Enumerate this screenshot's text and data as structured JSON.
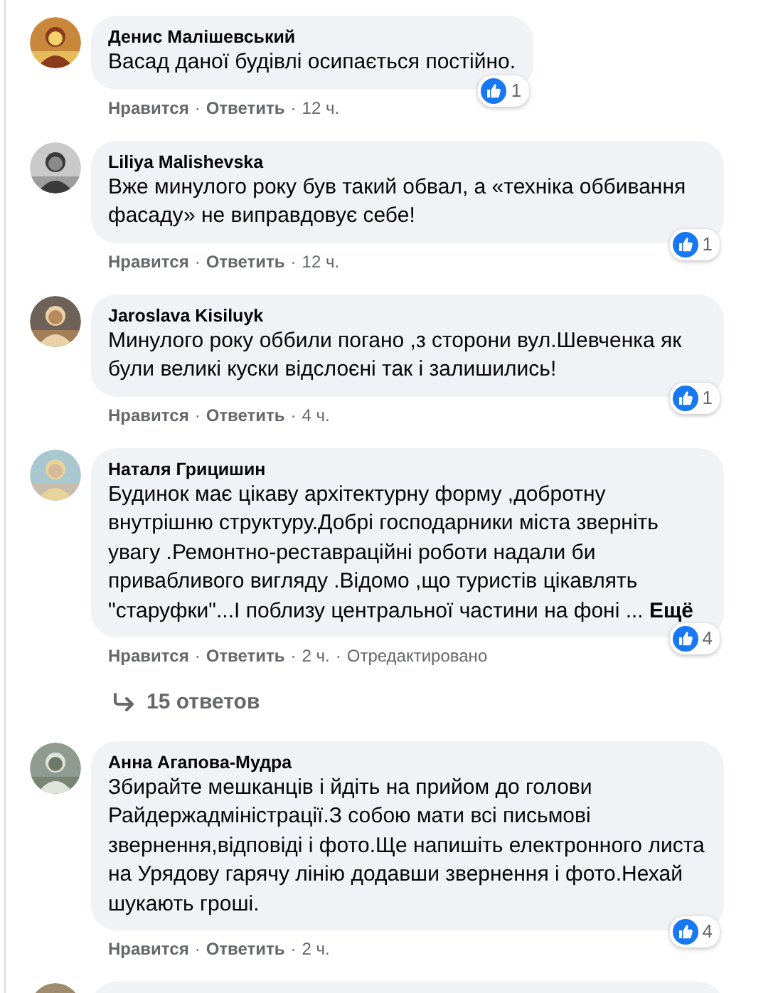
{
  "comments": [
    {
      "author": "Денис Малішевський",
      "text": "Васад даної будівлі осипається постійно.",
      "reactions": "1",
      "actions": [
        {
          "kind": "link",
          "text": "Нравится"
        },
        {
          "kind": "sep",
          "text": "·"
        },
        {
          "kind": "link",
          "text": "Ответить"
        },
        {
          "kind": "sep",
          "text": "·"
        },
        {
          "kind": "time",
          "text": "12 ч."
        }
      ]
    },
    {
      "author": "Liliya Malishevska",
      "text": "Вже минулого року був такий обвал, а «техніка оббивання фасаду» не виправдовує себе!",
      "reactions": "1",
      "actions": [
        {
          "kind": "link",
          "text": "Нравится"
        },
        {
          "kind": "sep",
          "text": "·"
        },
        {
          "kind": "link",
          "text": "Ответить"
        },
        {
          "kind": "sep",
          "text": "·"
        },
        {
          "kind": "time",
          "text": "12 ч."
        }
      ]
    },
    {
      "author": "Jaroslava Kisiluyk",
      "text": "Минулого року оббили погано ,з сторони вул.Шевченка як були великі куски відслоєні так і залишились!",
      "reactions": "1",
      "actions": [
        {
          "kind": "link",
          "text": "Нравится"
        },
        {
          "kind": "sep",
          "text": "·"
        },
        {
          "kind": "link",
          "text": "Ответить"
        },
        {
          "kind": "sep",
          "text": "·"
        },
        {
          "kind": "time",
          "text": "4 ч."
        }
      ]
    },
    {
      "author": "Наталя Грицишин",
      "text": "Будинок має цікаву архітектурну форму ,добротну внутрішню структуру.Добрі господарники міста зверніть увагу .Ремонтно-реставраційні роботи надали би привабливого вигляду .Відомо ,що туристів цікавлять \"старуфки\"...І поблизу центральної частини на фоні ...",
      "more_link": "Ещё",
      "reactions": "4",
      "actions": [
        {
          "kind": "link",
          "text": "Нравится"
        },
        {
          "kind": "sep",
          "text": "·"
        },
        {
          "kind": "link",
          "text": "Ответить"
        },
        {
          "kind": "sep",
          "text": "·"
        },
        {
          "kind": "time",
          "text": "2 ч."
        },
        {
          "kind": "sep",
          "text": "·"
        },
        {
          "kind": "time",
          "text": "Отредактировано"
        }
      ],
      "replies_link": "15 ответов"
    },
    {
      "author": "Анна Агапова-Мудра",
      "text": "Збирайте мешканців і йдіть на прийом до голови Райдержадміністрації.З собою мати всі письмові звернення,відповіді і фото.Ще напишіть електронного листа на Урядову гарячу лінію додавши звернення і фото.Нехай шукають гроші.",
      "reactions": "4",
      "actions": [
        {
          "kind": "link",
          "text": "Нравится"
        },
        {
          "kind": "sep",
          "text": "·"
        },
        {
          "kind": "link",
          "text": "Ответить"
        },
        {
          "kind": "sep",
          "text": "·"
        },
        {
          "kind": "time",
          "text": "2 ч."
        }
      ]
    },
    {
      "cut_off": true
    }
  ]
}
